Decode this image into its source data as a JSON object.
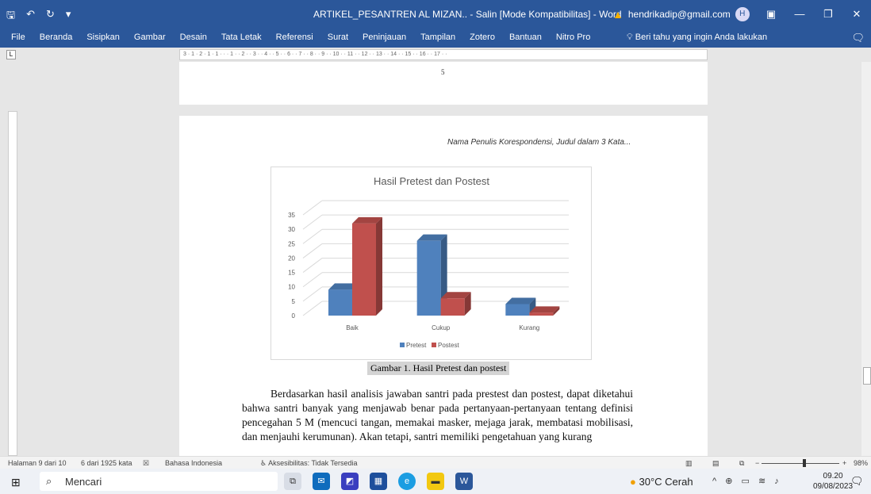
{
  "titlebar": {
    "title": "ARTIKEL_PESANTREN AL MIZAN.. - Salin [Mode Kompatibilitas] - Word",
    "account": "hendrikadip@gmail.com",
    "avatar": "H"
  },
  "menu": [
    "File",
    "Beranda",
    "Sisipkan",
    "Gambar",
    "Desain",
    "Tata Letak",
    "Referensi",
    "Surat",
    "Peninjauan",
    "Tampilan",
    "Zotero",
    "Bantuan",
    "Nitro Pro"
  ],
  "tell_me": "Beri tahu yang ingin Anda lakukan",
  "ruler_text": "3 · 1 · 2 · 1 · 1 · · · 1 · · 2 · · 3 · · 4 · · 5 · · 6 · · 7 · · 8 · · 9 · · 10 · · 11 · · 12 · · 13 · · 14 · · 15 · · 16 · · 17 · ·",
  "page_number": "5",
  "running_header": "Nama Penulis Korespondensi, Judul dalam 3 Kata...",
  "chart_data": {
    "type": "bar",
    "title": "Hasil Pretest dan Postest",
    "categories": [
      "Baik",
      "Cukup",
      "Kurang"
    ],
    "series": [
      {
        "name": "Pretest",
        "values": [
          9,
          26,
          4
        ],
        "color": "#4f81bd"
      },
      {
        "name": "Postest",
        "values": [
          32,
          6,
          1
        ],
        "color": "#c0504d"
      }
    ],
    "yticks": [
      "0",
      "5",
      "10",
      "15",
      "20",
      "25",
      "30",
      "35"
    ],
    "ylim": [
      0,
      35
    ],
    "grid": true,
    "legend": "bottom"
  },
  "caption": "Gambar 1. Hasil Pretest dan postest",
  "paragraph": "Berdasarkan hasil analisis jawaban santri pada prestest dan postest, dapat diketahui bahwa santri banyak yang menjawab benar pada pertanyaan-pertanyaan tentang definisi pencegahan 5 M (mencuci tangan, memakai masker, mejaga jarak, membatasi mobilisasi, dan menjauhi kerumunan). Akan tetapi, santri memiliki pengetahuan yang kurang",
  "status": {
    "page": "Halaman 9 dari 10",
    "words": "6 dari 1925 kata",
    "language": "Bahasa Indonesia",
    "accessibility": "Aksesibilitas: Tidak Tersedia",
    "zoom": "98%"
  },
  "taskbar": {
    "search": "Mencari",
    "weather": "30°C Cerah",
    "time": "09.20",
    "date": "09/08/2023",
    "notifications": "9"
  }
}
